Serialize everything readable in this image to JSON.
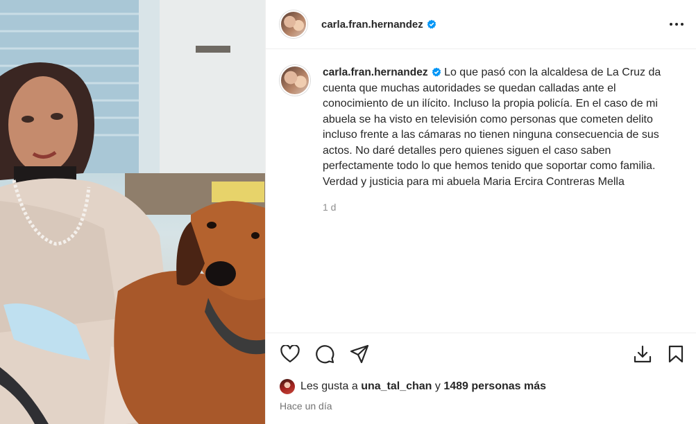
{
  "post": {
    "username": "carla.fran.hernandez",
    "verified": true,
    "caption": "Lo que pasó con la alcaldesa de La Cruz da cuenta que muchas autoridades se quedan calladas ante el conocimiento de un ilícito. Incluso la propia policía. En el caso de mi abuela se ha visto en televisión como personas que cometen delito incluso frente a las cámaras no tienen ninguna consecuencia de sus actos. No daré detalles pero quienes siguen el caso saben perfectamente todo lo que hemos tenido que soportar como familia. Verdad y justicia para mi abuela Maria Ercira Contreras Mella",
    "caption_age": "1 d",
    "likes_prefix": "Les gusta a",
    "liked_by": "una_tal_chan",
    "likes_joiner": "y",
    "likes_others": "1489 personas más",
    "posted_ago": "Hace un día"
  },
  "icons": {
    "verified": "verified-badge-icon",
    "more": "more-options-icon",
    "like": "heart-icon",
    "comment": "comment-icon",
    "share": "send-icon",
    "download": "download-icon",
    "save": "bookmark-icon"
  },
  "colors": {
    "verified_blue": "#0095f6",
    "text_primary": "#262626",
    "text_secondary": "#8e8e8e",
    "border": "#efefef"
  }
}
